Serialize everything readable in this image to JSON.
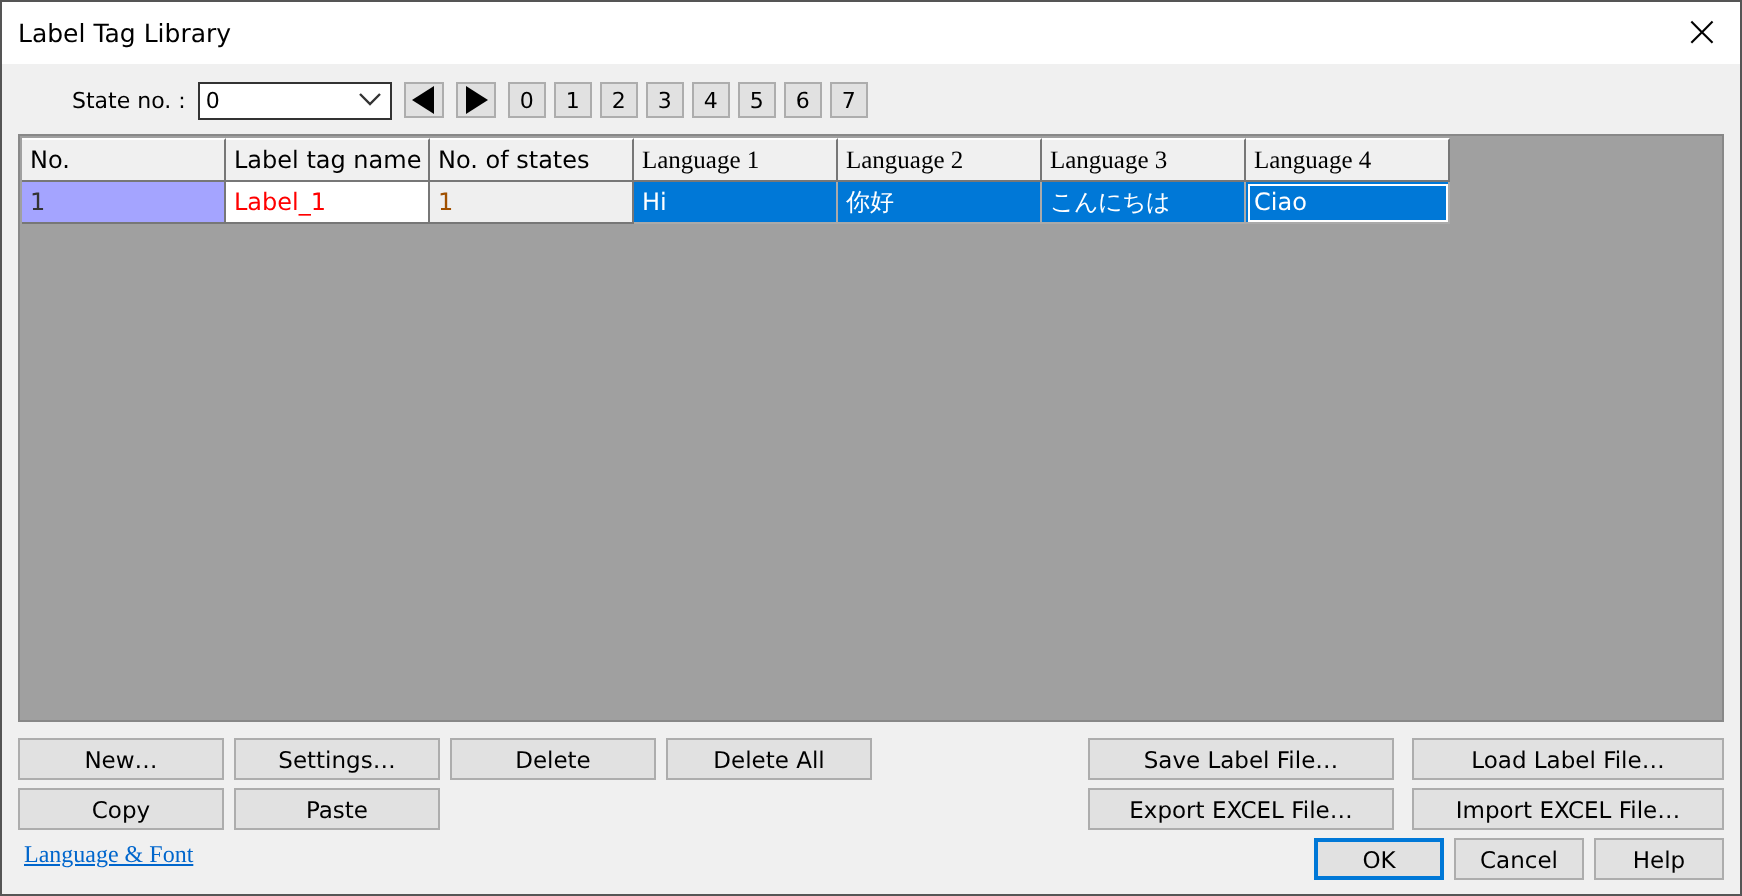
{
  "window": {
    "title": "Label Tag Library",
    "close": "×"
  },
  "state_selector": {
    "label": "State no. :",
    "value": "0",
    "nav": [
      {
        "kind": "prev"
      },
      {
        "kind": "next"
      }
    ],
    "numbers": [
      "0",
      "1",
      "2",
      "3",
      "4",
      "5",
      "6",
      "7"
    ]
  },
  "table": {
    "columns": [
      {
        "label": "No.",
        "kind": "sans"
      },
      {
        "label": "Label tag name",
        "kind": "sans"
      },
      {
        "label": "No. of states",
        "kind": "sans"
      },
      {
        "label": "Language 1",
        "kind": "serif"
      },
      {
        "label": "Language 2",
        "kind": "serif"
      },
      {
        "label": "Language 3",
        "kind": "serif"
      },
      {
        "label": "Language 4",
        "kind": "serif"
      }
    ],
    "rows": [
      {
        "selected": true,
        "cells": [
          {
            "text": "1",
            "kind": "id"
          },
          {
            "text": "Label_1",
            "kind": "name"
          },
          {
            "text": "1",
            "kind": "count"
          },
          {
            "text": "Hi",
            "kind": "text",
            "selected": true,
            "focused": false
          },
          {
            "text": "你好",
            "kind": "text",
            "selected": true,
            "focused": false
          },
          {
            "text": "こんにちは",
            "kind": "text",
            "selected": true,
            "focused": false
          },
          {
            "text": "Ciao",
            "kind": "text",
            "selected": true,
            "focused": true
          }
        ]
      }
    ]
  },
  "edit_buttons": [
    [
      "New…",
      "Settings…",
      "Delete",
      "Delete All"
    ],
    [
      "Copy",
      "Paste"
    ]
  ],
  "file_buttons": [
    [
      "Save Label File…",
      "Load Label File…"
    ],
    [
      "Export EXCEL File…",
      "Import EXCEL File…"
    ]
  ],
  "link": "Language & Font",
  "dialog_buttons": [
    {
      "label": "OK",
      "default": true
    },
    {
      "label": "Cancel",
      "default": false
    },
    {
      "label": "Help",
      "default": false
    }
  ]
}
